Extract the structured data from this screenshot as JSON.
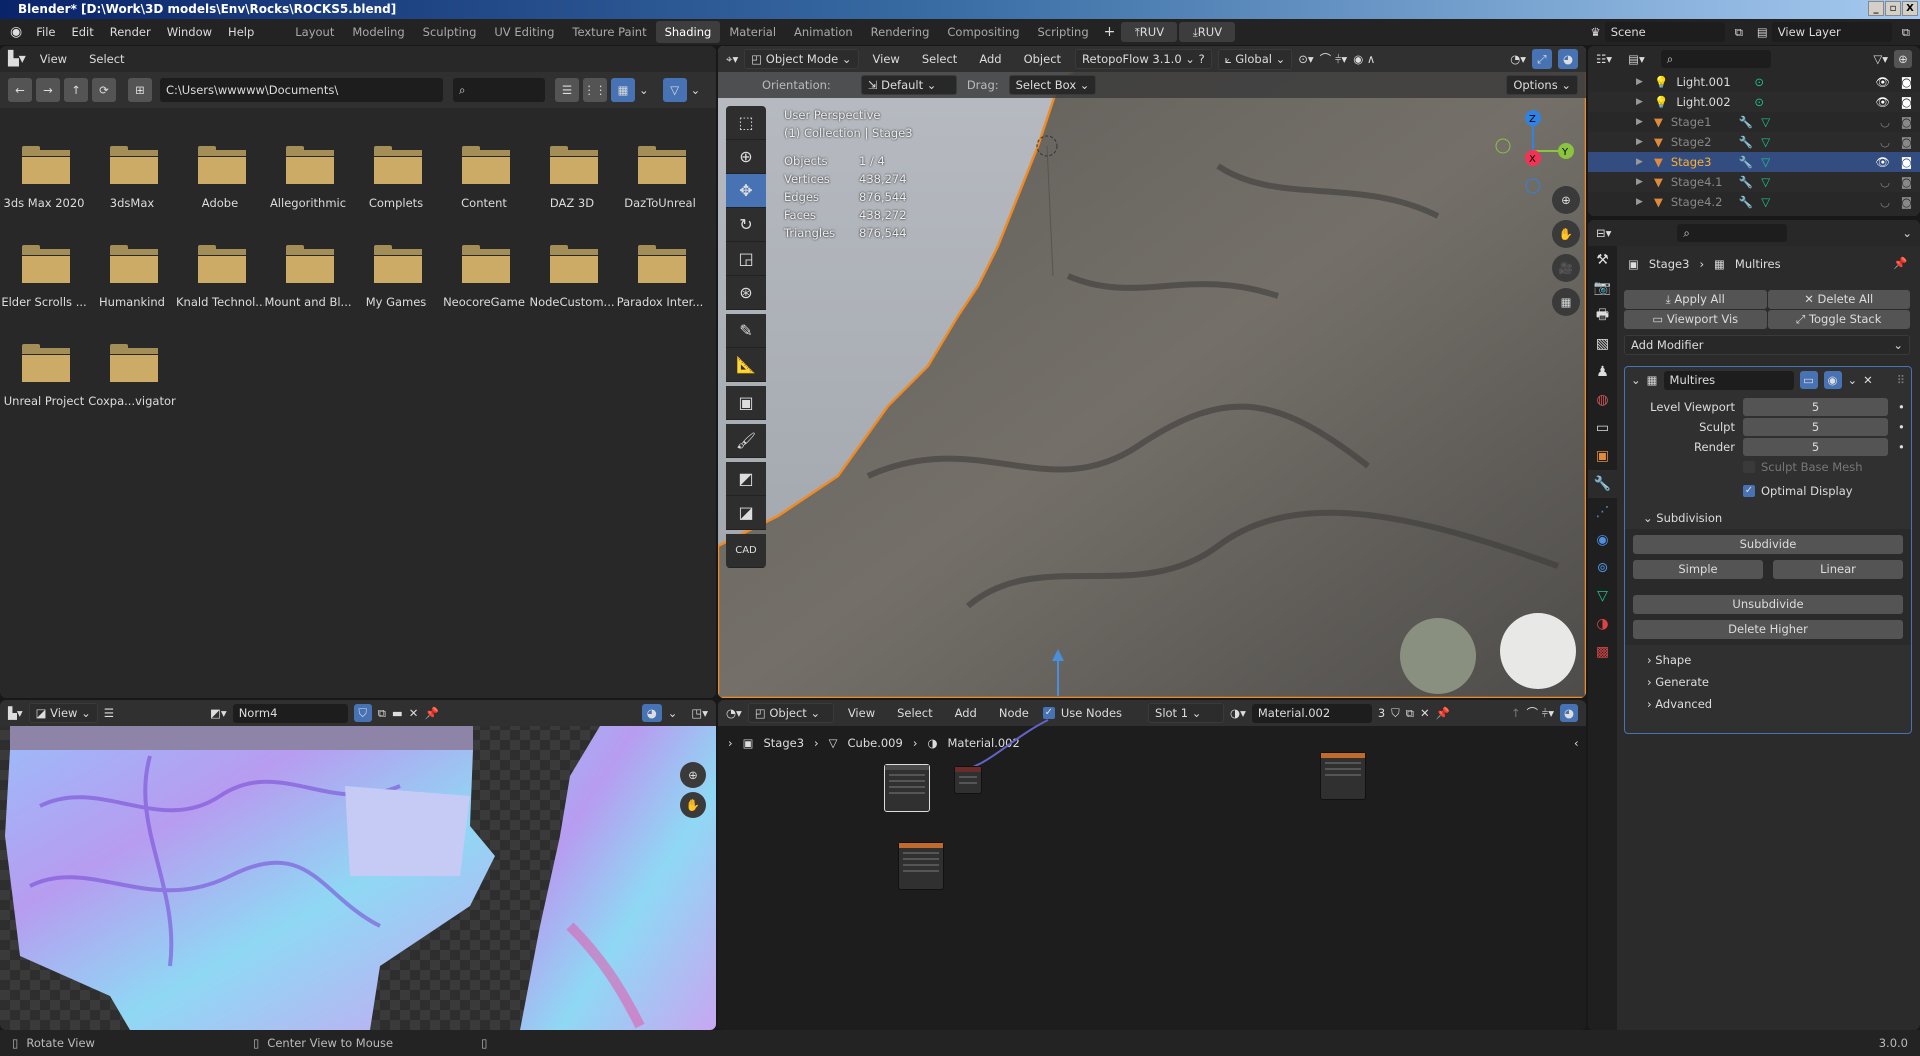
{
  "window": {
    "title": "Blender* [D:\\Work\\3D models\\Env\\Rocks\\ROCKS5.blend]",
    "controls": [
      "_",
      "▫",
      "X"
    ]
  },
  "menu": [
    "File",
    "Edit",
    "Render",
    "Window",
    "Help"
  ],
  "workspaces": [
    "Layout",
    "Modeling",
    "Sculpting",
    "UV Editing",
    "Texture Paint",
    "Shading",
    "Material",
    "Animation",
    "Rendering",
    "Compositing",
    "Scripting"
  ],
  "active_workspace": "Shading",
  "ruv": [
    "RUV",
    "RUV"
  ],
  "scene": "Scene",
  "view_layer": "View Layer",
  "file_browser": {
    "menu": [
      "View",
      "Select"
    ],
    "path": "C:\\Users\\wwwww\\Documents\\",
    "folders": [
      "3ds Max 2020",
      "3dsMax",
      "Adobe",
      "Allegorithmic",
      "Complets",
      "Content",
      "DAZ 3D",
      "DazToUnreal",
      "Elder Scrolls ...",
      "Humankind",
      "Knald Technol...",
      "Mount and Bl...",
      "My Games",
      "NeocoreGame",
      "NodeCustom...",
      "Paradox Inter...",
      "Unreal Project",
      "Coxpa...vigator"
    ]
  },
  "viewport": {
    "mode": "Object Mode",
    "menu": [
      "View",
      "Select",
      "Add",
      "Object"
    ],
    "addon": "RetopoFlow 3.1.0",
    "transform": "Global",
    "orientation_label": "Orientation:",
    "orientation": "Default",
    "drag_label": "Drag:",
    "drag": "Select Box",
    "options": "Options",
    "info": [
      "User Perspective",
      "(1) Collection | Stage3"
    ],
    "stats": [
      [
        "Objects",
        "1 / 4"
      ],
      [
        "Vertices",
        "438,274"
      ],
      [
        "Edges",
        "876,544"
      ],
      [
        "Faces",
        "438,272"
      ],
      [
        "Triangles",
        "876,544"
      ]
    ],
    "gizmo": {
      "z": "Z",
      "y": "Y",
      "x": "X"
    },
    "cad": "CAD"
  },
  "outliner": {
    "items": [
      {
        "name": "Light.001",
        "type": "light",
        "visible": true
      },
      {
        "name": "Light.002",
        "type": "light",
        "visible": true
      },
      {
        "name": "Stage1",
        "type": "mesh",
        "visible": false
      },
      {
        "name": "Stage2",
        "type": "mesh",
        "visible": false
      },
      {
        "name": "Stage3",
        "type": "mesh",
        "visible": true,
        "selected": true
      },
      {
        "name": "Stage4.1",
        "type": "mesh",
        "visible": false
      },
      {
        "name": "Stage4.2",
        "type": "mesh",
        "visible": false
      }
    ]
  },
  "properties": {
    "breadcrumb": [
      "Stage3",
      "Multires"
    ],
    "apply_all": "Apply All",
    "delete_all": "Delete All",
    "viewport_vis": "Viewport Vis",
    "toggle_stack": "Toggle Stack",
    "add_modifier": "Add Modifier",
    "modifier": {
      "name": "Multires",
      "level_viewport_label": "Level Viewport",
      "level_viewport": "5",
      "sculpt_label": "Sculpt",
      "sculpt": "5",
      "render_label": "Render",
      "render": "5",
      "sculpt_base_mesh": "Sculpt Base Mesh",
      "sculpt_base_mesh_checked": false,
      "optimal_display": "Optimal Display",
      "optimal_display_checked": true,
      "subdivision": "Subdivision",
      "subdivide": "Subdivide",
      "simple": "Simple",
      "linear": "Linear",
      "unsubdivide": "Unsubdivide",
      "delete_higher": "Delete Higher",
      "shape": "Shape",
      "generate": "Generate",
      "advanced": "Advanced"
    }
  },
  "image_editor": {
    "view": "View",
    "image": "Norm4"
  },
  "node_editor": {
    "type": "Object",
    "menu": [
      "View",
      "Select",
      "Add",
      "Node"
    ],
    "use_nodes": "Use Nodes",
    "use_nodes_checked": true,
    "slot": "Slot 1",
    "material": "Material.002",
    "users": "3",
    "breadcrumb": [
      "Stage3",
      "Cube.009",
      "Material.002"
    ]
  },
  "status": {
    "rotate": "Rotate View",
    "center": "Center View to Mouse",
    "version": "3.0.0"
  },
  "colors": {
    "accent": "#4772b3",
    "folder": "#cbab65",
    "selection": "#334d80",
    "active_text": "#ffaf29"
  }
}
